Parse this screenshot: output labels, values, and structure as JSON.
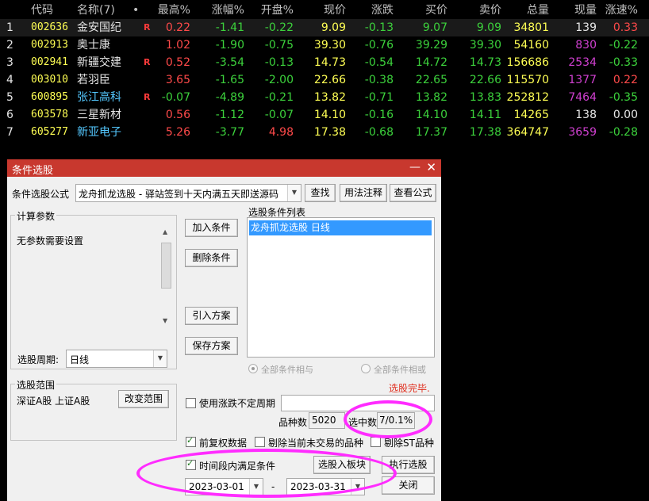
{
  "table": {
    "headers": {
      "code": "代码",
      "name": "名称(7)",
      "dot": "•",
      "high_pct": "最高%",
      "change_pct": "涨幅%",
      "open_pct": "开盘%",
      "price": "现价",
      "change": "涨跌",
      "bid": "买价",
      "ask": "卖价",
      "volume": "总量",
      "current_vol": "现量",
      "speed": "涨速%"
    },
    "rows": [
      {
        "idx": "1",
        "code": "002636",
        "name": "金安国纪",
        "r": "R",
        "high_pct": "0.22",
        "change_pct": "-1.41",
        "open_pct": "-0.22",
        "price": "9.09",
        "change": "-0.13",
        "bid": "9.07",
        "ask": "9.09",
        "volume": "34801",
        "current_vol": "139",
        "speed": "0.33"
      },
      {
        "idx": "2",
        "code": "002913",
        "name": "奥士康",
        "r": "",
        "high_pct": "1.02",
        "change_pct": "-1.90",
        "open_pct": "-0.75",
        "price": "39.30",
        "change": "-0.76",
        "bid": "39.29",
        "ask": "39.30",
        "volume": "54160",
        "current_vol": "830",
        "speed": "-0.22"
      },
      {
        "idx": "3",
        "code": "002941",
        "name": "新疆交建",
        "r": "R",
        "high_pct": "0.52",
        "change_pct": "-3.54",
        "open_pct": "-0.13",
        "price": "14.73",
        "change": "-0.54",
        "bid": "14.72",
        "ask": "14.73",
        "volume": "156686",
        "current_vol": "2534",
        "speed": "-0.33"
      },
      {
        "idx": "4",
        "code": "003010",
        "name": "若羽臣",
        "r": "",
        "high_pct": "3.65",
        "change_pct": "-1.65",
        "open_pct": "-2.00",
        "price": "22.66",
        "change": "-0.38",
        "bid": "22.65",
        "ask": "22.66",
        "volume": "115570",
        "current_vol": "1377",
        "speed": "0.22"
      },
      {
        "idx": "5",
        "code": "600895",
        "name": "张江高科",
        "r": "R",
        "high_pct": "-0.07",
        "change_pct": "-4.89",
        "open_pct": "-0.21",
        "price": "13.82",
        "change": "-0.71",
        "bid": "13.82",
        "ask": "13.83",
        "volume": "252812",
        "current_vol": "7464",
        "speed": "-0.35"
      },
      {
        "idx": "6",
        "code": "603578",
        "name": "三星新材",
        "r": "",
        "high_pct": "0.56",
        "change_pct": "-1.12",
        "open_pct": "-0.07",
        "price": "14.10",
        "change": "-0.16",
        "bid": "14.10",
        "ask": "14.11",
        "volume": "14265",
        "current_vol": "138",
        "speed": "0.00"
      },
      {
        "idx": "7",
        "code": "605277",
        "name": "新亚电子",
        "r": "",
        "high_pct": "5.26",
        "change_pct": "-3.77",
        "open_pct": "4.98",
        "price": "17.38",
        "change": "-0.68",
        "bid": "17.37",
        "ask": "17.38",
        "volume": "364747",
        "current_vol": "3659",
        "speed": "-0.28"
      }
    ]
  },
  "dialog": {
    "title": "条件选股",
    "minimize": "—",
    "close": "✕",
    "formula_label": "条件选股公式",
    "formula_value": "龙舟抓龙选股 - 驿站签到十天内满五天即送源码",
    "find_button": "查找",
    "usage_button": "用法注释",
    "view_formula_button": "查看公式",
    "params_group": "计算参数",
    "params_text": "无参数需要设置",
    "period_label": "选股周期:",
    "period_value": "日线",
    "add_condition": "加入条件",
    "delete_condition": "删除条件",
    "import_plan": "引入方案",
    "save_plan": "保存方案",
    "conditions_list_label": "选股条件列表",
    "conditions": [
      "龙舟抓龙选股  日线"
    ],
    "radio_and": "全部条件相与",
    "radio_or": "全部条件相或",
    "status": "选股完毕.",
    "range_group": "选股范围",
    "range_value": "深证A股 上证A股",
    "change_range": "改变范围",
    "use_period": "使用涨跌不定周期",
    "count_label": "品种数",
    "count_value": "5020",
    "hit_label": "选中数",
    "hit_value": "7/0.1%",
    "adjusted_data": "前复权数据",
    "exclude_untraded": "剔除当前未交易的品种",
    "exclude_st": "剔除ST品种",
    "time_range": "时间段内满足条件",
    "add_to_block": "选股入板块",
    "execute": "执行选股",
    "close_button": "关闭",
    "date_start": "2023-03-01",
    "date_sep": "-",
    "date_end": "2023-03-31"
  },
  "colors": {
    "title_bar": "#c8382e",
    "highlight_oval": "#ff2cff",
    "selected_item": "#3399ff"
  }
}
